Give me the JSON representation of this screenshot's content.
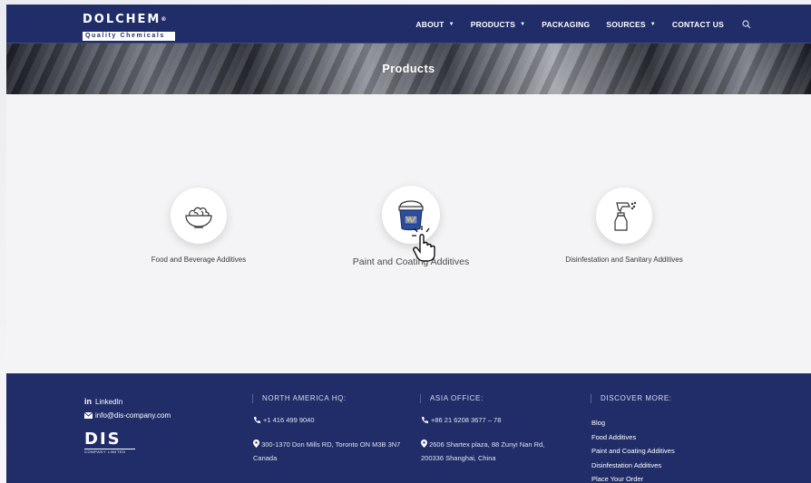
{
  "header": {
    "logo_top": "DOLCHEM",
    "logo_trademark": "®",
    "logo_bottom": "Quality Chemicals",
    "nav": [
      {
        "label": "ABOUT",
        "has_dropdown": true
      },
      {
        "label": "PRODUCTS",
        "has_dropdown": true
      },
      {
        "label": "PACKAGING",
        "has_dropdown": false
      },
      {
        "label": "SOURCES",
        "has_dropdown": true
      },
      {
        "label": "CONTACT US",
        "has_dropdown": false
      }
    ],
    "caret_glyph": "▼"
  },
  "banner": {
    "title": "Products"
  },
  "products": [
    {
      "label": "Food and  Beverage Additives",
      "icon": "food-bowl-icon"
    },
    {
      "label": "Paint and Coating Additives",
      "icon": "paint-bucket-icon"
    },
    {
      "label": "Disinfestation and Sanitary Additives",
      "icon": "spray-bottle-icon"
    }
  ],
  "footer": {
    "linkedin": "LinkedIn",
    "linkedin_glyph": "in",
    "email": "info@dis-company.com",
    "dis_logo": "DIS",
    "dis_sub": "COMPANY LIMITED",
    "north_america": {
      "heading": "NORTH AMERICA HQ:",
      "phone": "+1 416 499 9040",
      "address": "300-1370 Don Mills RD, Toronto ON M3B 3N7 Canada"
    },
    "asia": {
      "heading": "ASIA OFFICE:",
      "phone": "+86 21 6208 3677 – 78",
      "address": "2606 Shartex plaza, 88 Zunyi Nan Rd, 200336 Shanghai, China"
    },
    "discover": {
      "heading": "DISCOVER MORE:",
      "links": [
        "Blog",
        "Food Additives",
        "Paint and Coating Additives",
        "Disinfestation Additives",
        "Place Your Order"
      ]
    }
  },
  "colors": {
    "navy": "#202d69",
    "page_bg": "#f4f4f6",
    "bucket_blue": "#2a4fa0"
  }
}
